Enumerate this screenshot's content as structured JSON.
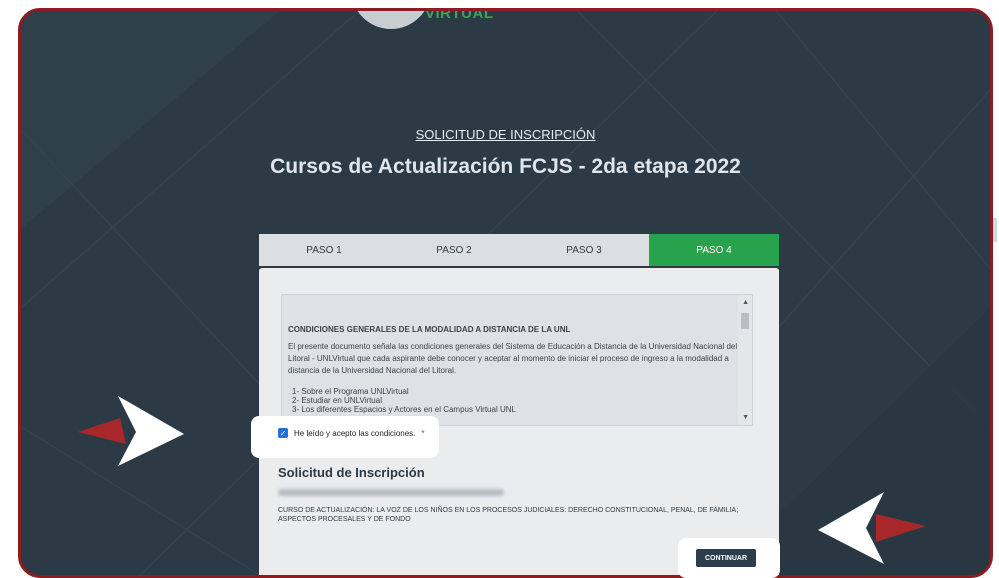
{
  "header": {
    "logo_text": "VIRTUAL",
    "subtitle": "SOLICITUD DE INSCRIPCIÓN",
    "title": "Cursos de Actualización FCJS - 2da etapa 2022"
  },
  "tabs": [
    {
      "label": "PASO 1",
      "active": false
    },
    {
      "label": "PASO 2",
      "active": false
    },
    {
      "label": "PASO 3",
      "active": false
    },
    {
      "label": "PASO 4",
      "active": true
    }
  ],
  "terms": {
    "heading": "CONDICIONES GENERALES DE LA MODALIDAD A DISTANCIA DE LA UNL",
    "paragraph": "El presente documento señala las condiciones generales del Sistema de Educación a Distancia de la Universidad Nacional del Litoral - UNLVirtual que cada aspirante debe conocer y aceptar al momento de iniciar el proceso de ingreso a la modalidad a distancia de la Universidad Nacional del Litoral.",
    "items": [
      "1- Sobre el Programa UNLVirtual",
      "2- Estudiar en UNLVirtual",
      "3- Los diferentes Espacios y Actores en el Campus Virtual UNL"
    ]
  },
  "accept": {
    "label": "He leído y acepto las condiciones.",
    "required_mark": "*",
    "checked": true
  },
  "request": {
    "section_title": "Solicitud de Inscripción",
    "course": "CURSO DE ACTUALIZACIÓN: LA VOZ DE LOS NIÑOS EN LOS PROCESOS JUDICIALES: DERECHO CONSTITUCIONAL, PENAL, DE FAMILIA; ASPECTOS PROCESALES Y DE FONDO"
  },
  "actions": {
    "continue_label": "CONTINUAR"
  },
  "colors": {
    "frame_border": "#8d1b1f",
    "background": "#2c3a45",
    "active_tab": "#28a24d",
    "arrow_red": "#a8272b",
    "arrow_white": "#ffffff",
    "button": "#2c3e4c"
  },
  "icons": {
    "checkbox": "check-icon",
    "left_pointer": "arrow-right-icon",
    "right_pointer": "arrow-left-icon"
  }
}
